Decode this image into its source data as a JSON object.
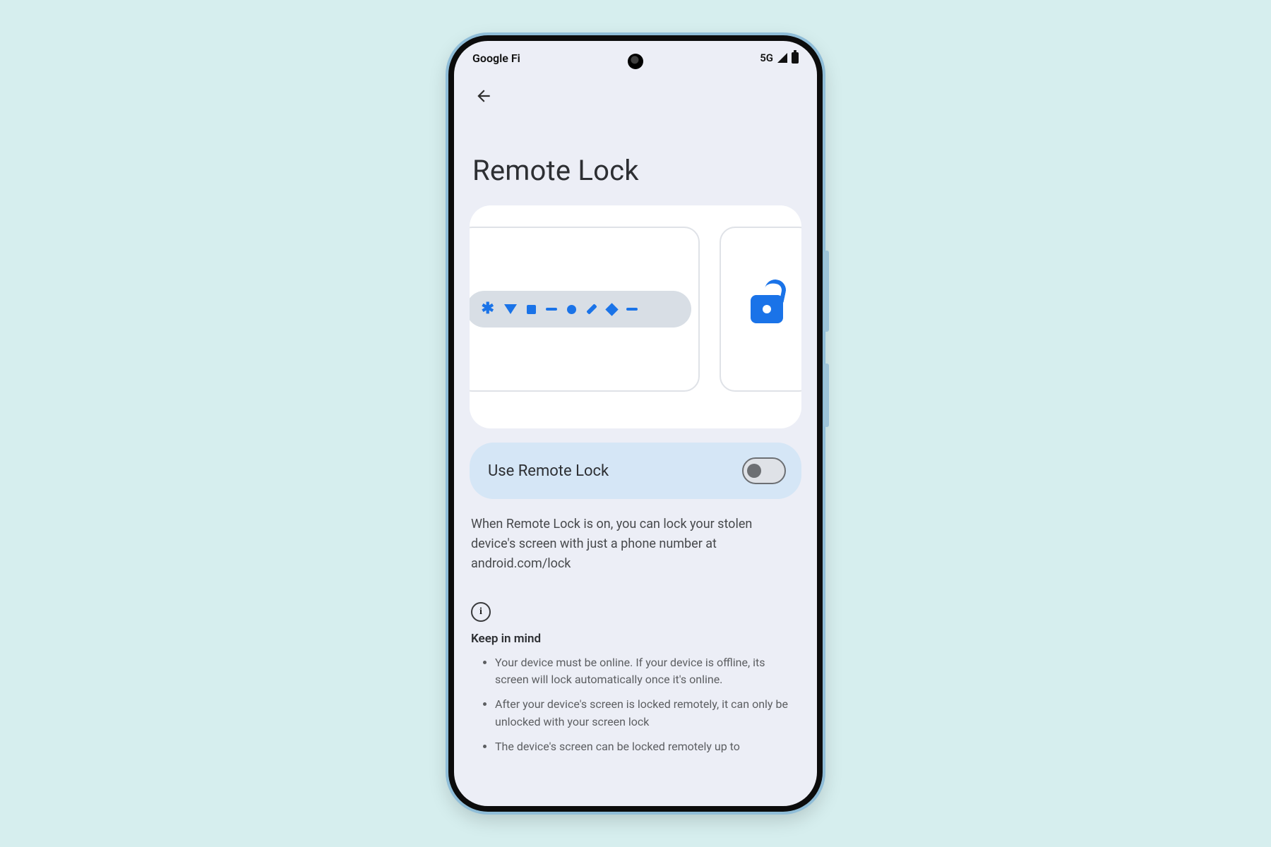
{
  "status": {
    "carrier": "Google Fi",
    "network": "5G"
  },
  "page": {
    "title": "Remote Lock"
  },
  "toggle": {
    "label": "Use Remote Lock",
    "on": false
  },
  "description": "When Remote Lock is on, you can lock your stolen device's screen with just a phone number at android.com/lock",
  "info": {
    "heading": "Keep in mind",
    "items": [
      "Your device must be online. If your device is offline, its screen will lock automatically once it's online.",
      "After your device's screen is locked remotely, it can only be unlocked with your screen lock",
      "The device's screen can be locked remotely up to"
    ]
  }
}
